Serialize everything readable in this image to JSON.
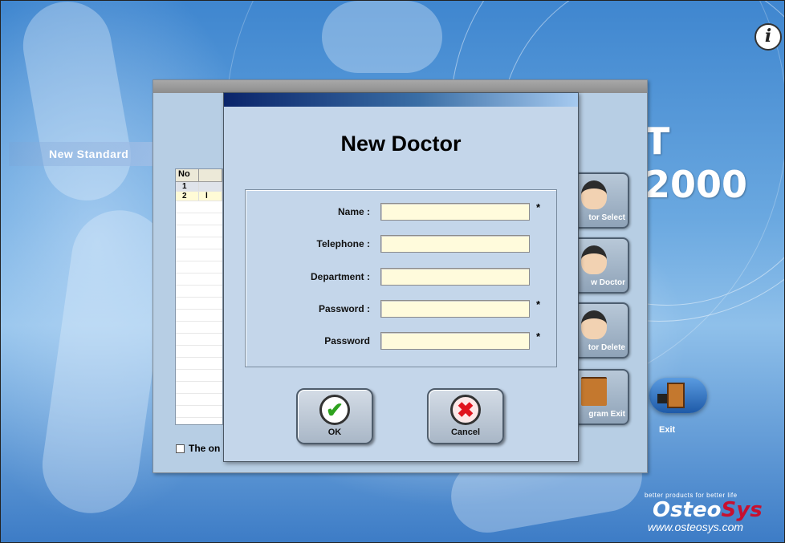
{
  "app": {
    "subtitle": "New Standard",
    "title_fragment": "T 2000",
    "info_icon": "i",
    "exit_label": "Exit",
    "brand": {
      "tagline": "better products for better life",
      "name_prefix": "Osteo",
      "name_suffix": "Sys",
      "url": "www.osteosys.com",
      "accent_color": "#c8102e"
    }
  },
  "doctor_window": {
    "list_header": {
      "col1": "No",
      "col2": ""
    },
    "rows": [
      {
        "no": "1",
        "name": ""
      },
      {
        "no": "2",
        "name": "l"
      }
    ],
    "checkbox_label": "The on",
    "side_buttons": [
      {
        "label": "tor Select",
        "icon": "doctor-check-icon"
      },
      {
        "label": "w Doctor",
        "icon": "doctor-new-icon"
      },
      {
        "label": "tor Delete",
        "icon": "doctor-delete-icon"
      },
      {
        "label": "gram Exit",
        "icon": "door-exit-icon"
      }
    ]
  },
  "dialog": {
    "title": "New Doctor",
    "fields": [
      {
        "label": "Name :",
        "value": "",
        "required": "*"
      },
      {
        "label": "Telephone :",
        "value": "",
        "required": ""
      },
      {
        "label": "Department :",
        "value": "",
        "required": ""
      },
      {
        "label": "Password :",
        "value": "",
        "required": "*"
      },
      {
        "label": "Password",
        "value": "",
        "required": "*"
      }
    ],
    "ok_label": "OK",
    "cancel_label": "Cancel",
    "ok_icon": "✔",
    "cancel_icon": "✖",
    "input_color": "#fffbdc"
  }
}
